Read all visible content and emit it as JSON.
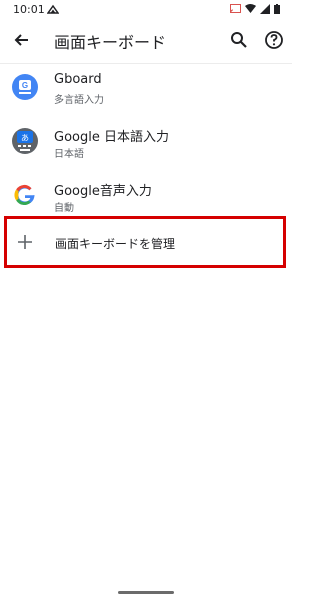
{
  "status_bar": {
    "time": "10:01"
  },
  "app_bar": {
    "title": "画面キーボード"
  },
  "keyboards": [
    {
      "title": "Gboard",
      "subtitle": "多言語入力",
      "icon": "gboard-icon"
    },
    {
      "title": "Google 日本語入力",
      "subtitle": "日本語",
      "icon": "google-japanese-input-icon"
    },
    {
      "title": "Google音声入力",
      "subtitle": "自動",
      "icon": "google-g-icon"
    }
  ],
  "manage": {
    "label": "画面キーボードを管理",
    "icon": "plus-icon"
  },
  "colors": {
    "highlight_border": "#d50000",
    "google_blue": "#4285F4"
  }
}
